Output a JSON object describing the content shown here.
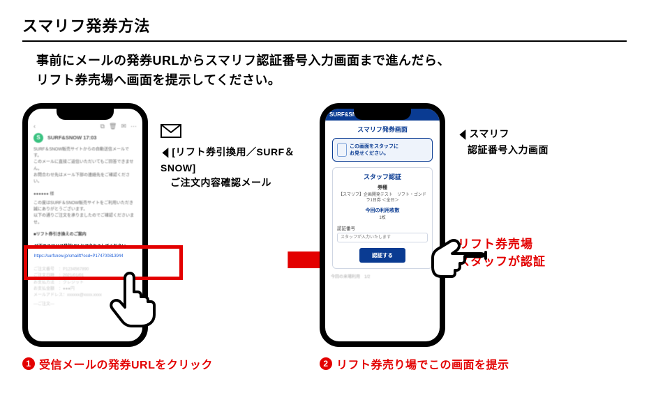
{
  "title": "スマリフ発券方法",
  "lead": "事前にメールの発券URLからスマリフ認証番号入力画面まで進んだら、\nリフト券売場へ画面を提示してください。",
  "left": {
    "annotation_line1": "[リフト券引換用／SURF＆SNOW]",
    "annotation_line2": "ご注文内容確認メール",
    "caption": "受信メールの発券URLをクリック",
    "email": {
      "sender_initial": "S",
      "sender_name": "SURF&SNOW  17:03",
      "body_intro1": "SURF＆SNOW販売サイトからの自動送信メールです。",
      "body_intro2": "このメールに直接ご返信いただいてもご回答できません。",
      "body_intro3": "お問合わせ先はメール下部の連絡先をご確認ください。",
      "greeting_masked": "●●●●●● 様",
      "thanks1": "この度はSURF＆SNOW販売サイトをご利用いただき誠にありがとうございます。",
      "thanks2": "以下の通りご注文を承りましたのでご確認くださいませ。",
      "section_heading": "■リフト券引き換えのご案内",
      "highlight_instruction": "以下のスマリフ発行URLにアクセスしてください。",
      "highlight_url": "https://surfsnow.jp/smalift?ocd=P174700813944",
      "dim_line1": "ご注文番号　：P1234567890",
      "dim_line2": "ご注文日時　：2021/01/01",
      "dim_line3": "お支払方法　：クレジット",
      "dim_line4": "お支払金額　：●●●円",
      "dim_line5": "メールアドレス：xxxxxx@xxxx.xxxx",
      "dim_line6": "---ご注文---"
    }
  },
  "right": {
    "annotation_line1": "スマリフ",
    "annotation_line2": "認証番号入力画面",
    "big_keyword_line1": "リフト券売場",
    "big_keyword_line2": "スタッフが認証",
    "caption": "リフト券売り場でこの画面を提示",
    "screen": {
      "brand": "SURF&SNOW",
      "page_title": "スマリフ発券画面",
      "speech_line1": "この画面をスタッフに",
      "speech_line2": "お見せください。",
      "card_title": "スタッフ認証",
      "ticket_label": "券種",
      "ticket_name": "【スマリフ】企画開発テスト　リフト・ゴンドラ1日券 ＜全日＞",
      "count_label": "今回の利用枚数",
      "count_value": "1枚",
      "input_label": "認証番号",
      "input_placeholder": "スタッフが入力いたします",
      "button": "認証する",
      "footer": "今回の来場利用　1/2"
    }
  }
}
